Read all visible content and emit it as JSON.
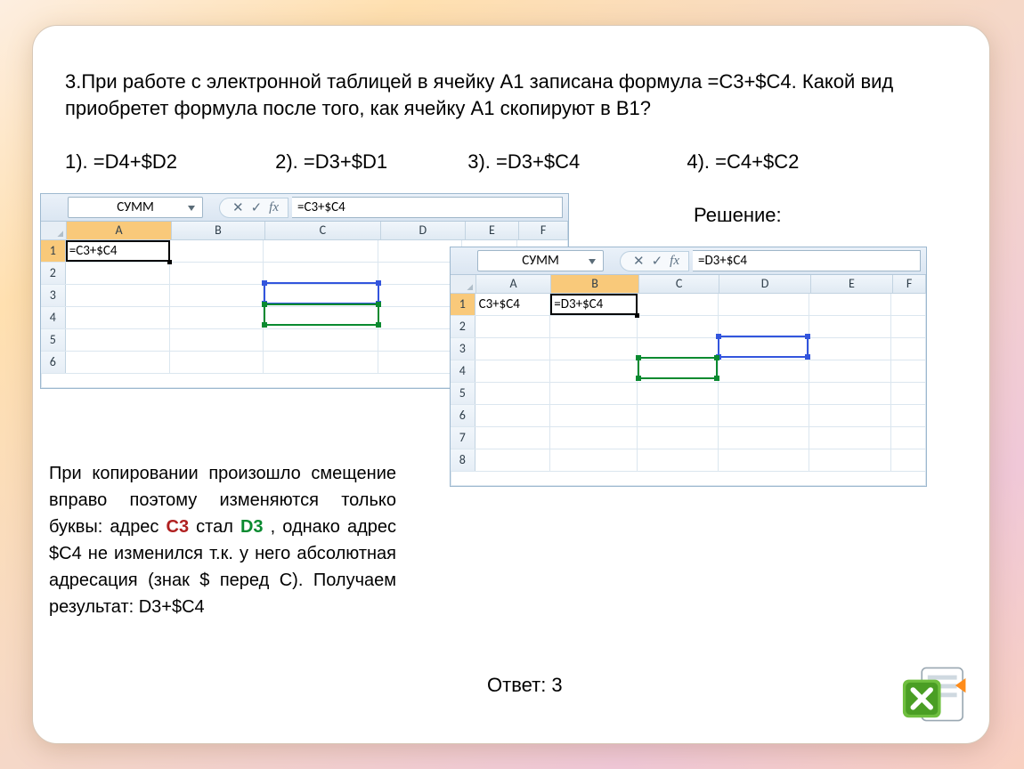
{
  "question": "3.При работе с электронной таблицей в ячейку А1 записана формула =С3+$С4. Какой вид приобретет формула после того, как  ячейку А1 скопируют в В1?",
  "options": {
    "o1": "1). =D4+$D2",
    "o2": "2). =D3+$D1",
    "o3": "3). =D3+$C4",
    "o4": "4). =C4+$C2"
  },
  "solution_label": "Решение:",
  "xl1": {
    "namebox": "СУММ",
    "formula": "=C3+$C4",
    "cols": [
      "A",
      "B",
      "C",
      "D",
      "E",
      "F"
    ],
    "rows": [
      "1",
      "2",
      "3",
      "4",
      "5",
      "6"
    ],
    "a1": "=C3+$C4"
  },
  "xl2": {
    "namebox": "СУММ",
    "formula": "=D3+$C4",
    "cols": [
      "A",
      "B",
      "C",
      "D",
      "E",
      "F"
    ],
    "rows": [
      "1",
      "2",
      "3",
      "4",
      "5",
      "6",
      "7",
      "8"
    ],
    "a1": "C3+$C4",
    "b1": "=D3+$C4"
  },
  "explain_parts": {
    "p1": "При копировании произошло смещение вправо поэтому изменяются только буквы: адрес ",
    "c3": "С3",
    "p2": " стал ",
    "d3": "D3",
    "p3": ", однако адрес $С4 не изменился т.к. у него абсолютная адресация (знак $ перед С). Получаем результат: D3+$C4"
  },
  "answer": "Ответ: 3",
  "fx_cancel": "✕",
  "fx_ok": "✓",
  "fx_label": "fx"
}
